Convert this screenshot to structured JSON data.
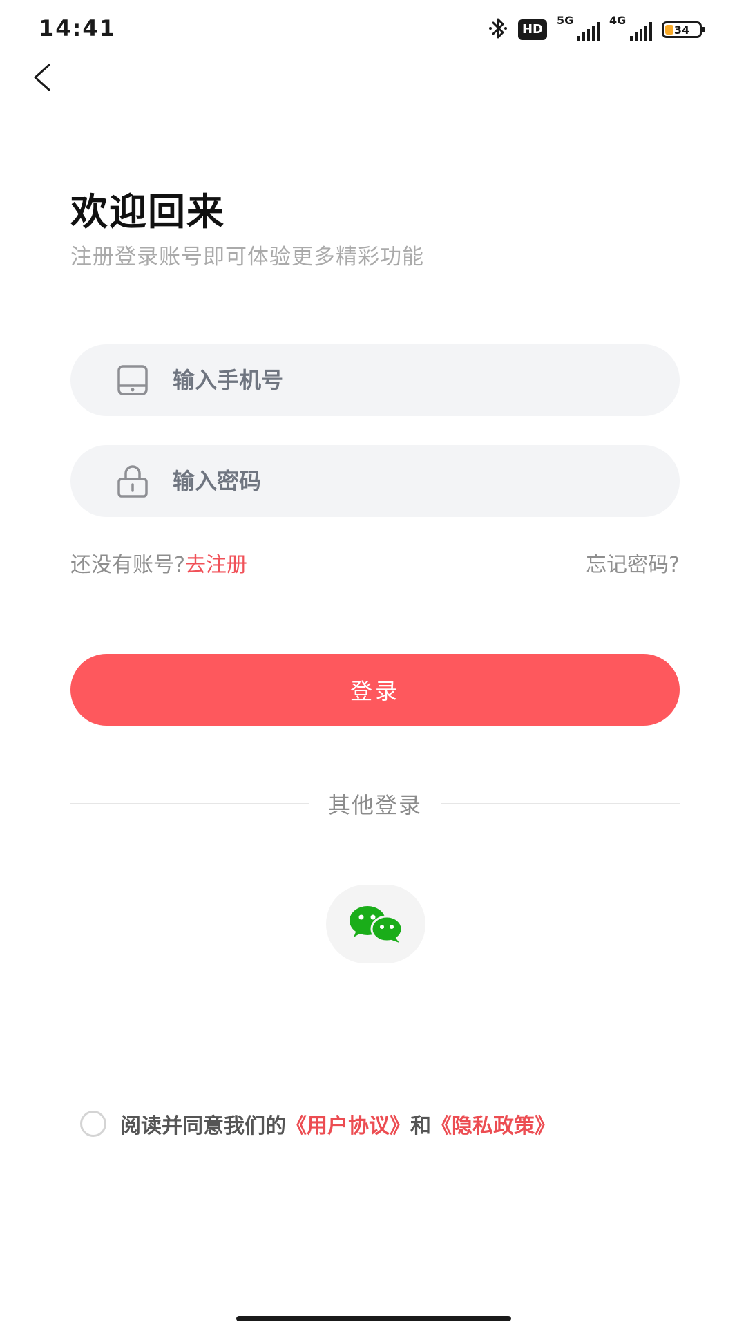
{
  "status_bar": {
    "time": "14:41",
    "hd_label": "HD",
    "net1_label": "5G",
    "net2_label": "4G",
    "battery_level": "34",
    "icons": [
      "bluetooth-icon",
      "hd-voice-icon",
      "signal-5g-icon",
      "signal-4g-icon",
      "battery-icon"
    ]
  },
  "header": {
    "title": "欢迎回来",
    "subtitle": "注册登录账号即可体验更多精彩功能"
  },
  "form": {
    "phone_placeholder": "输入手机号",
    "password_placeholder": "输入密码",
    "no_account_text": "还没有账号?",
    "register_link": "去注册",
    "forgot_link": "忘记密码?",
    "login_button": "登录"
  },
  "other_login": {
    "label": "其他登录",
    "providers": [
      "wechat"
    ]
  },
  "agreement": {
    "prefix": "阅读并同意我们的",
    "user_agreement": "《用户协议》",
    "conjunction": "和",
    "privacy_policy": "《隐私政策》"
  },
  "colors": {
    "accent": "#fe585d",
    "link": "#f05158",
    "field_bg": "#f3f4f6",
    "wechat_green": "#1aad19"
  }
}
